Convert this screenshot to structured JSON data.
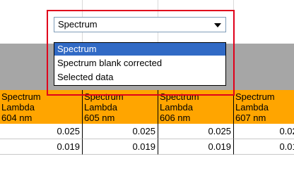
{
  "combo": {
    "selected_value": "Spectrum",
    "arrow_icon": "dropdown-arrow-icon"
  },
  "dropdown": {
    "options": [
      "Spectrum",
      "Spectrum blank corrected",
      "Selected data"
    ],
    "highlighted_index": 0
  },
  "table": {
    "columns": [
      {
        "line1": "Spectrum",
        "line2": "Lambda",
        "line3": "604 nm"
      },
      {
        "line1": "Spectrum",
        "line2": "Lambda",
        "line3": "605 nm"
      },
      {
        "line1": "Spectrum",
        "line2": "Lambda",
        "line3": "606 nm"
      },
      {
        "line1": "Spectrum",
        "line2": "Lambda",
        "line3": "607 nm"
      }
    ],
    "rows": [
      [
        "0.025",
        "0.025",
        "0.025",
        "0.025"
      ],
      [
        "0.019",
        "0.019",
        "0.019",
        "0.019"
      ]
    ]
  },
  "colors": {
    "header_bg": "#ffa500",
    "highlight_border": "#e0001b",
    "band_gray": "#a6a6a6",
    "selection_bg": "#316ac5"
  }
}
